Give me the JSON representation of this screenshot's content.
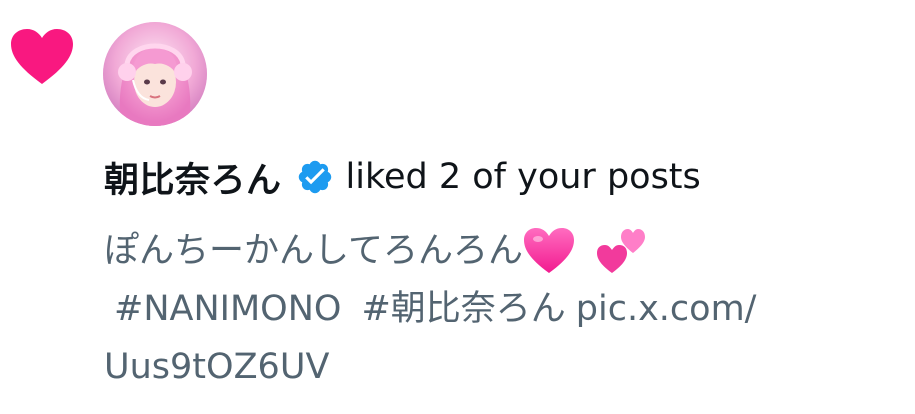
{
  "notification": {
    "type_icon": "heart-icon",
    "user": {
      "display_name": "朝比奈ろん",
      "verified": true,
      "verified_icon": "verified-badge-icon",
      "avatar": "avatar"
    },
    "action_text": "liked 2 of your posts",
    "post_preview": {
      "text": "ぽんちーかんしてろんろん",
      "emoji_1": "pink-heart-emoji",
      "emoji_2": "two-hearts-emoji",
      "hashtag_1": "#NANIMONO",
      "hashtag_2": "#朝比奈ろん",
      "link_part_1": "pic.x.com/",
      "link_part_2": "Uus9tOZ6UV"
    }
  },
  "colors": {
    "like_heart": "#f91880",
    "verified_blue": "#1d9bf0",
    "name_text": "#0f1419",
    "secondary_text": "#536471",
    "emoji_pink": "#ff3fa4"
  }
}
